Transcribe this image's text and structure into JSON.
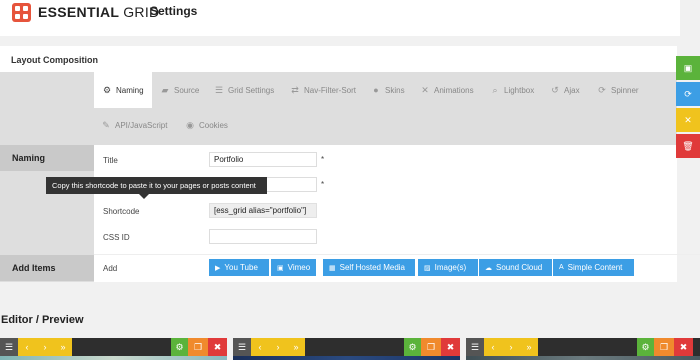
{
  "header": {
    "brand_bold": "ESSENTIAL",
    "brand_thin": "GRID",
    "page_title": "Settings"
  },
  "panel": {
    "title": "Layout Composition",
    "tabs": [
      {
        "label": "Naming",
        "icon": "gear-icon"
      },
      {
        "label": "Source",
        "icon": "folder-icon"
      },
      {
        "label": "Grid Settings",
        "icon": "list-icon"
      },
      {
        "label": "Nav-Filter-Sort",
        "icon": "shuffle-icon"
      },
      {
        "label": "Skins",
        "icon": "drop-icon"
      },
      {
        "label": "Animations",
        "icon": "tools-icon"
      },
      {
        "label": "Lightbox",
        "icon": "search-icon"
      },
      {
        "label": "Ajax",
        "icon": "undo-icon"
      },
      {
        "label": "Spinner",
        "icon": "refresh-icon"
      },
      {
        "label": "API/JavaScript",
        "icon": "magic-wand-icon"
      },
      {
        "label": "Cookies",
        "icon": "eye-icon"
      }
    ],
    "sections": {
      "naming": "Naming",
      "add_items": "Add Items"
    },
    "fields": {
      "title_label": "Title",
      "title_value": "Portfolio",
      "alias_value": "",
      "shortcode_label": "Shortcode",
      "shortcode_value": "[ess_grid alias=\"portfolio\"]",
      "css_id_label": "CSS ID",
      "css_id_value": "",
      "required_mark": "*",
      "add_label": "Add"
    },
    "tooltip": "Copy this shortcode to paste it to your pages or posts content",
    "add_buttons": [
      {
        "label": "You Tube",
        "icon": "youtube-icon"
      },
      {
        "label": "Vimeo",
        "icon": "vimeo-icon"
      },
      {
        "label": "Self Hosted Media",
        "icon": "film-icon"
      },
      {
        "label": "Image(s)",
        "icon": "image-icon"
      },
      {
        "label": "Sound Cloud",
        "icon": "soundcloud-icon"
      },
      {
        "label": "Simple Content",
        "icon": "text-icon"
      }
    ]
  },
  "side_actions": [
    {
      "name": "save",
      "icon": "save-icon",
      "color": "#5bb33b"
    },
    {
      "name": "refresh",
      "icon": "refresh-icon",
      "color": "#3c9ee5"
    },
    {
      "name": "close",
      "icon": "close-icon",
      "color": "#f0c31d"
    },
    {
      "name": "delete",
      "icon": "trash-icon",
      "color": "#e03a3a"
    }
  ],
  "editor": {
    "title": "Editor / Preview"
  },
  "colors": {
    "brand": "#e6543c",
    "accent_blue": "#3c9ee5",
    "green": "#5bb33b",
    "yellow": "#f0c31d",
    "red": "#e03a3a",
    "orange": "#f08a2d"
  }
}
